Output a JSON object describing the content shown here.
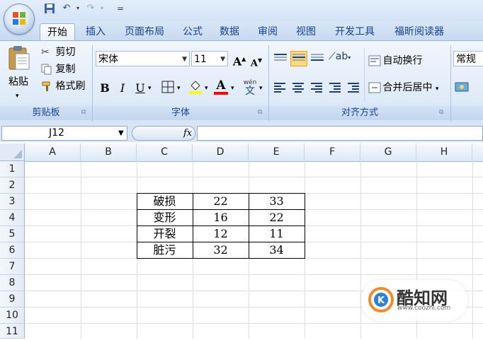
{
  "quick_access": {
    "customize": "="
  },
  "tabs": [
    {
      "label": "开始",
      "active": true
    },
    {
      "label": "插入"
    },
    {
      "label": "页面布局"
    },
    {
      "label": "公式"
    },
    {
      "label": "数据"
    },
    {
      "label": "审阅"
    },
    {
      "label": "视图"
    },
    {
      "label": "开发工具"
    },
    {
      "label": "福昕阅读器"
    }
  ],
  "clipboard": {
    "paste": "粘贴",
    "cut": "剪切",
    "copy": "复制",
    "format_painter": "格式刷",
    "group_label": "剪贴板"
  },
  "font": {
    "name": "宋体",
    "size": "11",
    "group_label": "字体",
    "bold": "B",
    "italic": "I",
    "underline": "U",
    "grow": "A",
    "shrink": "A",
    "font_color_letter": "A",
    "phonetic": "wén"
  },
  "alignment": {
    "wrap_text": "自动换行",
    "merge_center": "合并后居中",
    "group_label": "对齐方式"
  },
  "number": {
    "format": "常规"
  },
  "formula_bar": {
    "name_box": "J12",
    "fx": "fx",
    "formula": ""
  },
  "columns": [
    "A",
    "B",
    "C",
    "D",
    "E",
    "F",
    "G",
    "H"
  ],
  "rows": [
    "1",
    "2",
    "3",
    "4",
    "5",
    "6",
    "7",
    "8",
    "9",
    "10",
    "11"
  ],
  "table": [
    {
      "c": "破损",
      "d": "22",
      "e": "33"
    },
    {
      "c": "变形",
      "d": "16",
      "e": "22"
    },
    {
      "c": "开裂",
      "d": "12",
      "e": "11"
    },
    {
      "c": "脏污",
      "d": "32",
      "e": "34"
    }
  ],
  "watermark": {
    "name": "酷知网",
    "url": "www.coozhi.com"
  },
  "colors": {
    "ribbon_text": "#15428b",
    "font_color_bar": "#ff0000",
    "highlight_bar": "#ffff00"
  }
}
